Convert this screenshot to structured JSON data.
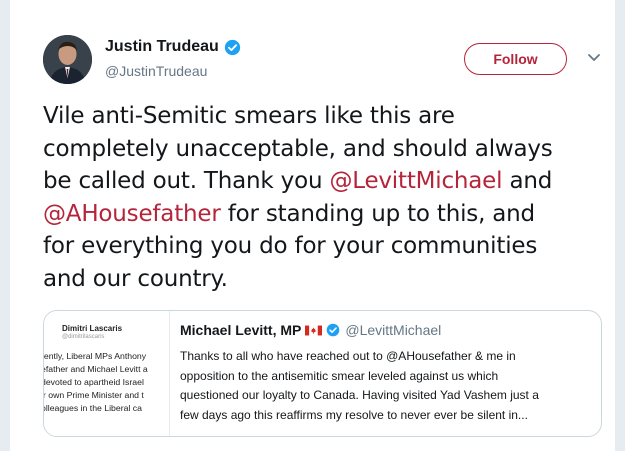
{
  "tweet": {
    "author": {
      "name": "Justin Trudeau",
      "handle": "@JustinTrudeau",
      "verified": true
    },
    "follow_label": "Follow",
    "text_lines": [
      [
        "Vile anti-Semitic smears like this are"
      ],
      [
        "completely unacceptable, and should always"
      ],
      [
        "be called out. Thank you ",
        "@LevittMichael",
        " and"
      ],
      [
        "@AHousefather",
        " for standing up to this, and"
      ],
      [
        "for everything you do for your communities"
      ],
      [
        "and our country."
      ]
    ],
    "colors": {
      "accent": "#b5243a",
      "text": "#14171a",
      "muted": "#657786",
      "border": "#ccd6dd",
      "verified": "#1da1f2"
    }
  },
  "quote": {
    "author": {
      "name": "Michael Levitt, MP",
      "handle": "@LevittMichael",
      "flag": "canada-flag-icon",
      "verified": true
    },
    "text_lines": [
      "Thanks to all who have reached out to @AHousefather & me in",
      "opposition to the antisemitic smear leveled against us which",
      "questioned  our loyalty to Canada. Having visited Yad Vashem just a",
      "few days ago this reaffirms my resolve to never ever be silent in..."
    ],
    "thumbnail": {
      "name": "Dimitri Lascaris",
      "handle": "@dimitrilascaris",
      "lines": [
        "rently, Liberal MPs Anthony",
        "efather and Michael Levitt a",
        "devoted to apartheid Israel",
        "ir own Prime Minister and t",
        "olleagues in the Liberal ca"
      ]
    }
  }
}
